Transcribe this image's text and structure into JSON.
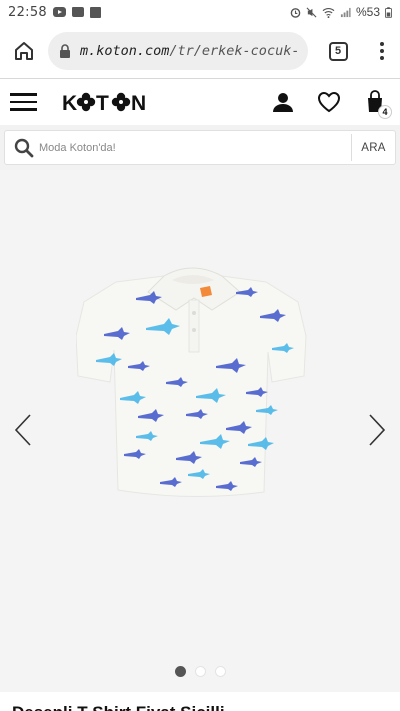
{
  "status_bar": {
    "time": "22:58",
    "battery": "%53"
  },
  "browser": {
    "url_host": "m.koton.com",
    "url_path": "/tr/erkek-cocuk-des",
    "tab_count": "5"
  },
  "site": {
    "logo": "KOTON",
    "cart_count": "4"
  },
  "search": {
    "placeholder": "Moda Koton'da!",
    "button_label": "ARA"
  },
  "gallery": {
    "slide_count": 3,
    "active_slide": 1
  },
  "product": {
    "title": "Desenli T-Shirt Fiyat Sicilli"
  },
  "colors": {
    "shark_light": "#3fb3e8",
    "shark_dark": "#3d56c9",
    "shirt": "#f7f7f4",
    "collar_tag": "#f28a3a"
  }
}
